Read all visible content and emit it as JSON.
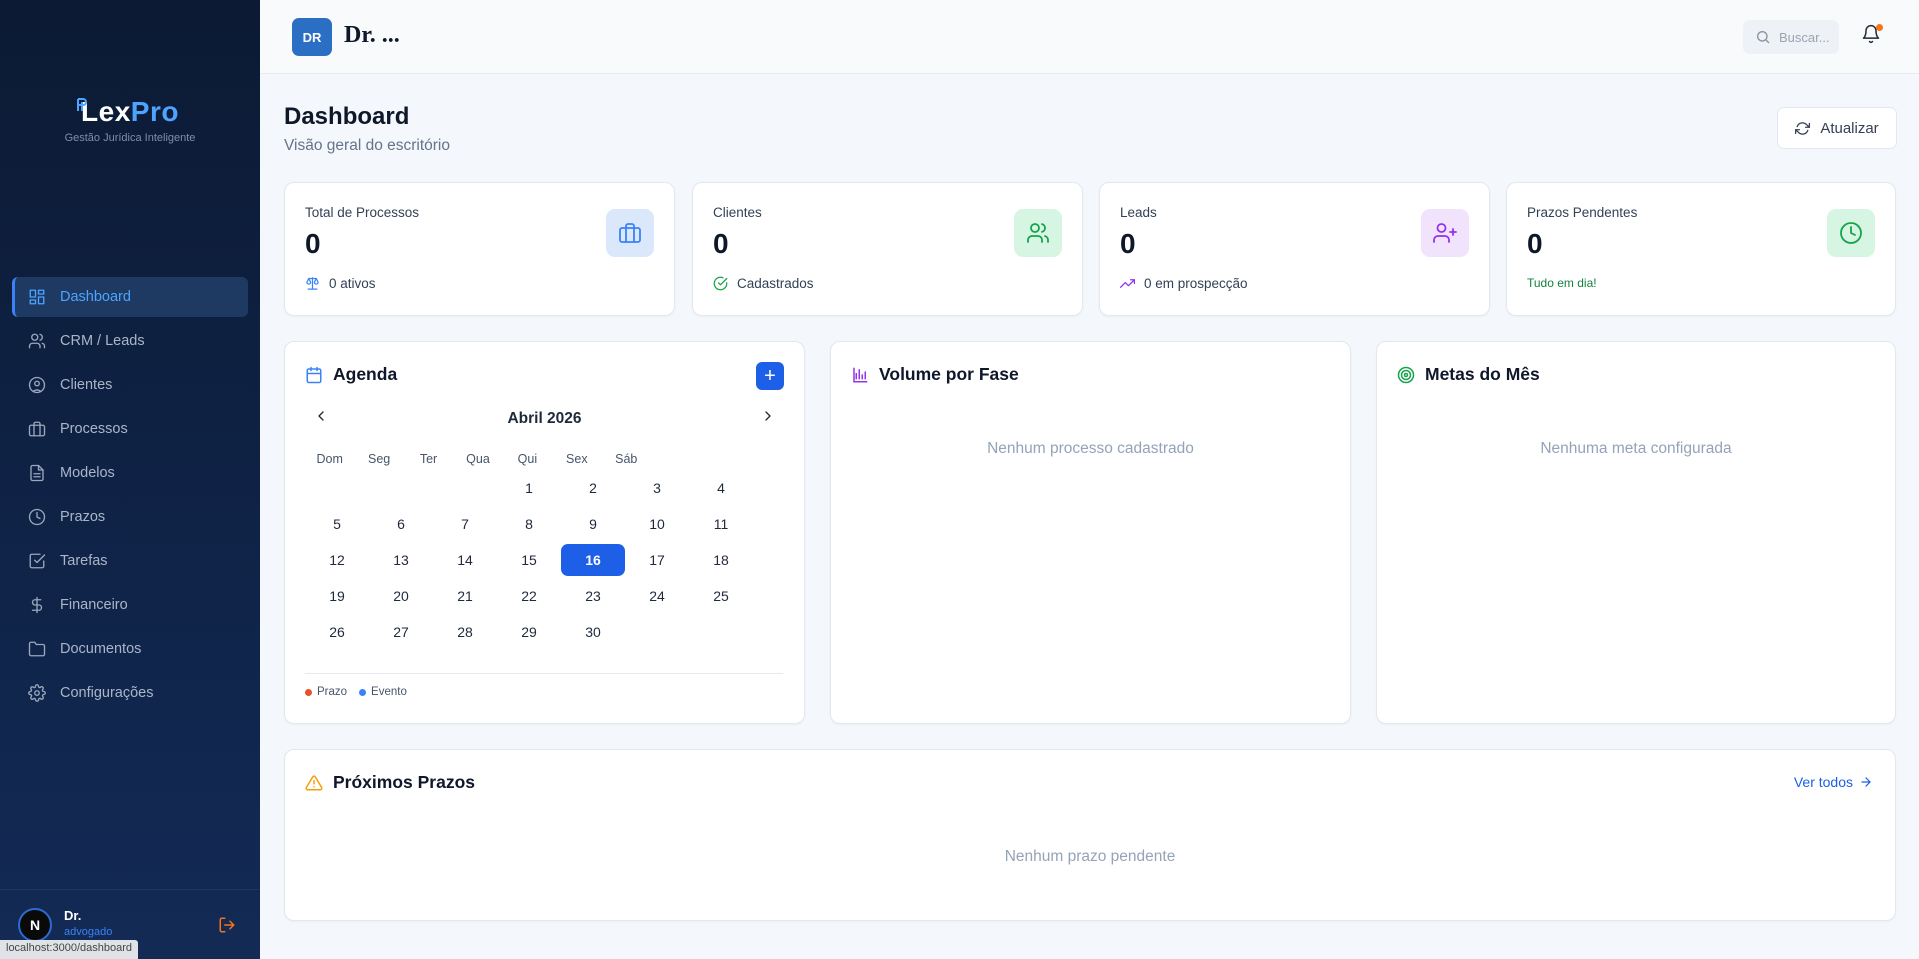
{
  "brand": {
    "name_part1": "Lex",
    "name_part2": "Pro",
    "tagline": "Gestão Jurídica Inteligente"
  },
  "sidebar": {
    "items": [
      {
        "label": "Dashboard",
        "icon": "grid-icon",
        "active": true
      },
      {
        "label": "CRM / Leads",
        "icon": "users-icon"
      },
      {
        "label": "Clientes",
        "icon": "user-circle-icon"
      },
      {
        "label": "Processos",
        "icon": "briefcase-icon"
      },
      {
        "label": "Modelos",
        "icon": "file-text-icon"
      },
      {
        "label": "Prazos",
        "icon": "clock-icon"
      },
      {
        "label": "Tarefas",
        "icon": "check-square-icon"
      },
      {
        "label": "Financeiro",
        "icon": "dollar-icon"
      },
      {
        "label": "Documentos",
        "icon": "folder-icon"
      },
      {
        "label": "Configurações",
        "icon": "gear-icon"
      }
    ],
    "user": {
      "initial": "N",
      "name": "Dr.",
      "role": "advogado"
    },
    "status_url": "localhost:3000/dashboard"
  },
  "topbar": {
    "badge": "DR",
    "title": "Dr. ...",
    "search_placeholder": "Buscar..."
  },
  "header": {
    "title": "Dashboard",
    "subtitle": "Visão geral do escritório",
    "refresh_label": "Atualizar"
  },
  "stats": [
    {
      "label": "Total de Processos",
      "value": "0",
      "foot": "0 ativos",
      "icon": "briefcase-icon",
      "accent": "#3b82f6"
    },
    {
      "label": "Clientes",
      "value": "0",
      "foot": "Cadastrados",
      "icon": "users-icon",
      "accent": "#16a34a"
    },
    {
      "label": "Leads",
      "value": "0",
      "foot": "0 em prospecção",
      "icon": "user-plus-icon",
      "accent": "#9333ea"
    },
    {
      "label": "Prazos Pendentes",
      "value": "0",
      "foot": "Tudo em dia!",
      "icon": "clock-icon",
      "accent": "#16a34a"
    }
  ],
  "agenda": {
    "title": "Agenda",
    "add_label": "+",
    "month": "Abril 2026",
    "weekdays": [
      "Dom",
      "Seg",
      "Ter",
      "Qua",
      "Qui",
      "Sex",
      "Sáb"
    ],
    "weeks": [
      [
        "",
        "",
        "",
        "1",
        "2",
        "3",
        "4"
      ],
      [
        "5",
        "6",
        "7",
        "8",
        "9",
        "10",
        "11"
      ],
      [
        "12",
        "13",
        "14",
        "15",
        "16",
        "17",
        "18"
      ],
      [
        "19",
        "20",
        "21",
        "22",
        "23",
        "24",
        "25"
      ],
      [
        "26",
        "27",
        "28",
        "29",
        "30",
        "",
        ""
      ]
    ],
    "today": "16",
    "legend": [
      {
        "label": "Prazo",
        "color": "#e5532d"
      },
      {
        "label": "Evento",
        "color": "#3b82f6"
      }
    ]
  },
  "volume": {
    "title": "Volume por Fase",
    "empty": "Nenhum processo cadastrado"
  },
  "goals": {
    "title": "Metas do Mês",
    "empty": "Nenhuma meta configurada"
  },
  "deadlines": {
    "title": "Próximos Prazos",
    "link": "Ver todos",
    "empty": "Nenhum prazo pendente"
  }
}
